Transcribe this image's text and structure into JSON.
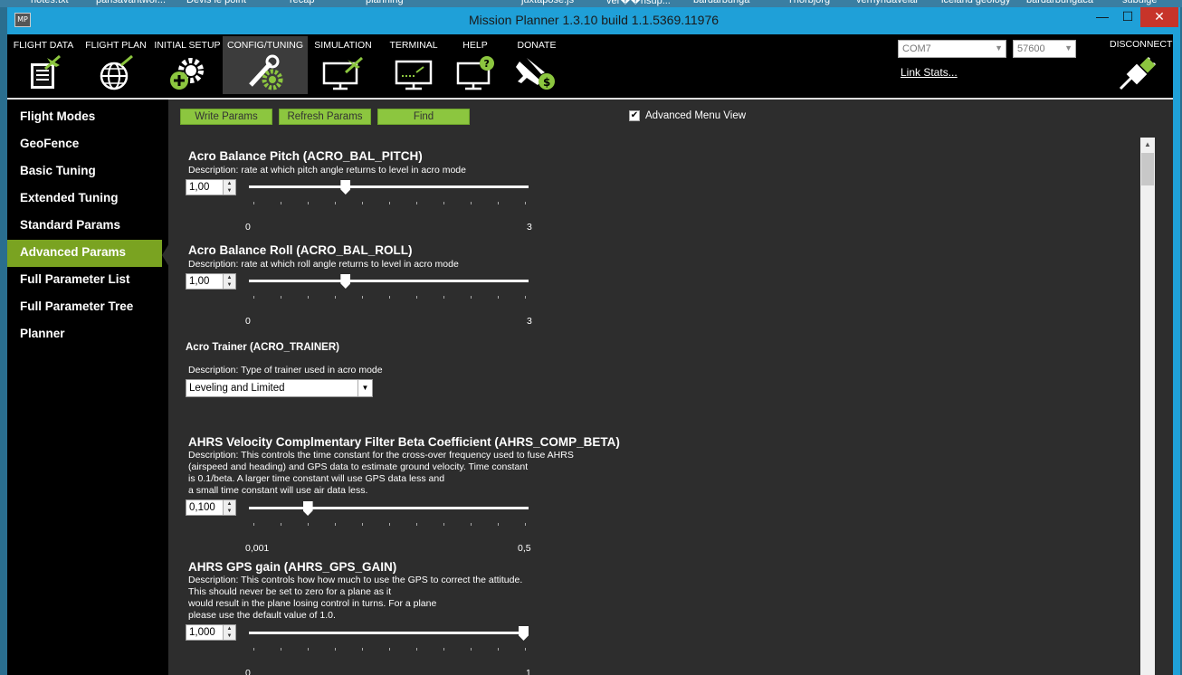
{
  "desktop_items": [
    "notes.txt",
    "pansavantwor...",
    "Devis le point",
    "recap",
    "planning",
    "juxtapose.js",
    "ver��nsup...",
    "bardarbunga",
    "Thorbjorg",
    "vernyndavelar",
    "iceland geology",
    "bardarbungaca",
    "subuige"
  ],
  "window": {
    "app_icon": "MP",
    "title": "Mission Planner 1.3.10 build 1.1.5369.11976",
    "minimize": "—",
    "maximize": "☐",
    "close": "✕"
  },
  "toolbar": {
    "buttons": [
      {
        "label": "FLIGHT DATA",
        "icon": "flight-data-icon"
      },
      {
        "label": "FLIGHT PLAN",
        "icon": "flight-plan-icon"
      },
      {
        "label": "INITIAL SETUP",
        "icon": "initial-setup-icon"
      },
      {
        "label": "CONFIG/TUNING",
        "icon": "config-tuning-icon"
      },
      {
        "label": "SIMULATION",
        "icon": "simulation-icon"
      },
      {
        "label": "TERMINAL",
        "icon": "terminal-icon"
      },
      {
        "label": "HELP",
        "icon": "help-icon"
      },
      {
        "label": "DONATE",
        "icon": "donate-icon"
      }
    ],
    "com_port": "COM7",
    "baud_rate": "57600",
    "link_stats": "Link Stats...",
    "disconnect": "DISCONNECT"
  },
  "sidebar": {
    "items": [
      {
        "label": "Flight Modes"
      },
      {
        "label": "GeoFence"
      },
      {
        "label": "Basic Tuning"
      },
      {
        "label": "Extended Tuning"
      },
      {
        "label": "Standard Params"
      },
      {
        "label": "Advanced Params"
      },
      {
        "label": "Full Parameter List"
      },
      {
        "label": "Full Parameter Tree"
      },
      {
        "label": "Planner"
      }
    ],
    "active_index": 5
  },
  "content": {
    "write_params": "Write Params",
    "refresh_params": "Refresh Params",
    "find": "Find",
    "advanced_menu_view": "Advanced Menu View",
    "advanced_checked": true,
    "check_mark": "✔",
    "params": [
      {
        "title": "Acro Balance Pitch (ACRO_BAL_PITCH)",
        "desc": [
          "Description: rate at which pitch angle returns to level in acro mode"
        ],
        "value": "1,00",
        "min": "0",
        "max": "3",
        "level": 0.34
      },
      {
        "title": "Acro Balance Roll (ACRO_BAL_ROLL)",
        "desc": [
          "Description: rate at which roll angle returns to level in acro mode"
        ],
        "value": "1,00",
        "min": "0",
        "max": "3",
        "level": 0.34
      },
      {
        "title": "Acro Trainer (ACRO_TRAINER)",
        "desc": [
          "Description: Type of trainer used in acro mode"
        ],
        "value": "Leveling and Limited"
      },
      {
        "title": "AHRS Velocity Complmentary Filter Beta Coefficient (AHRS_COMP_BETA)",
        "desc": [
          "Description: This controls the time constant for the cross-over frequency used to fuse AHRS",
          "(airspeed and heading) and GPS data to estimate ground velocity. Time constant",
          "is 0.1/beta. A larger time constant will use GPS data less and",
          "a small time constant will use air data less."
        ],
        "value": "0,100",
        "min": "0,001",
        "max": "0,5",
        "level": 0.2
      },
      {
        "title": "AHRS GPS gain (AHRS_GPS_GAIN)",
        "desc": [
          "Description: This controls how how much to use the GPS to correct the attitude.",
          "This should never be set to zero for a plane as it",
          "would result in the plane losing control in turns. For a plane",
          "please use the default value of 1.0."
        ],
        "value": "1,000",
        "min": "0",
        "max": "1",
        "level": 1.0
      }
    ]
  }
}
